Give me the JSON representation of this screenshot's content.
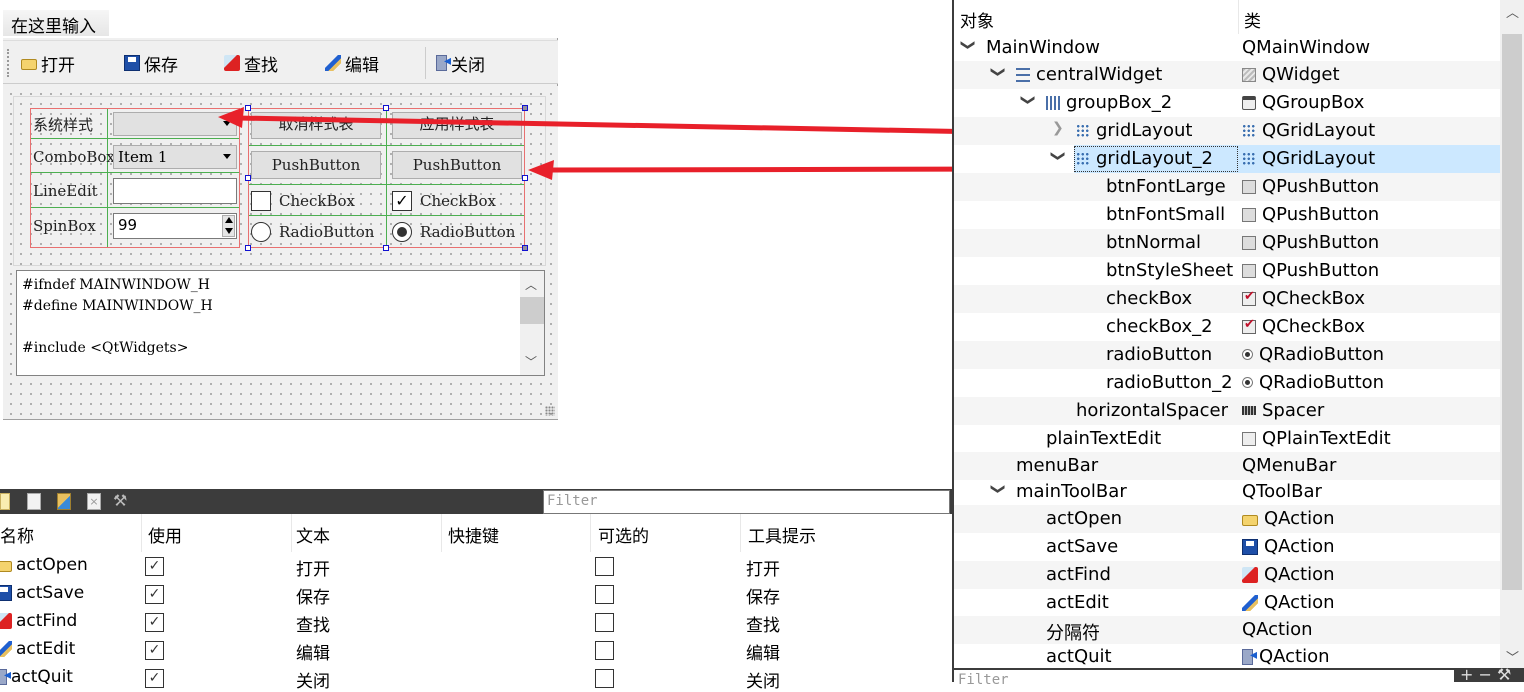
{
  "form": {
    "menu_placeholder": "在这里输入",
    "toolbar": [
      {
        "icon": "folder-open-icon",
        "label": "打开"
      },
      {
        "icon": "save-icon",
        "label": "保存"
      },
      {
        "icon": "find-icon",
        "label": "查找"
      },
      {
        "icon": "edit-icon",
        "label": "编辑"
      },
      {
        "icon": "quit-icon",
        "label": "关闭"
      }
    ],
    "grid1": {
      "labels": [
        "系统样式",
        "ComboBox",
        "LineEdit",
        "SpinBox"
      ],
      "style_combo_value": "",
      "combo_value": "Item 1",
      "lineedit_value": "",
      "spin_value": "99"
    },
    "grid2": {
      "buttons": [
        "取消样式表",
        "应用样式表",
        "PushButton",
        "PushButton"
      ],
      "checkboxes": [
        {
          "label": "CheckBox",
          "checked": false
        },
        {
          "label": "CheckBox",
          "checked": true
        }
      ],
      "radios": [
        {
          "label": "RadioButton",
          "checked": false
        },
        {
          "label": "RadioButton",
          "checked": true
        }
      ]
    },
    "plaintext_lines": [
      "#ifndef MAINWINDOW_H",
      "#define MAINWINDOW_H",
      "",
      "#include <QtWidgets>"
    ]
  },
  "action_editor": {
    "toolbar_icons": [
      "new-action-icon",
      "copy-action-icon",
      "paste-action-icon",
      "delete-action-icon",
      "configure-icon"
    ],
    "filter_placeholder": "Filter",
    "columns": [
      "名称",
      "使用",
      "文本",
      "快捷键",
      "可选的",
      "工具提示"
    ],
    "rows": [
      {
        "icon": "folder-open-icon",
        "name": "actOpen",
        "used": true,
        "text": "打开",
        "shortcut": "",
        "checkable": false,
        "tooltip": "打开"
      },
      {
        "icon": "save-icon",
        "name": "actSave",
        "used": true,
        "text": "保存",
        "shortcut": "",
        "checkable": false,
        "tooltip": "保存"
      },
      {
        "icon": "find-icon",
        "name": "actFind",
        "used": true,
        "text": "查找",
        "shortcut": "",
        "checkable": false,
        "tooltip": "查找"
      },
      {
        "icon": "edit-icon",
        "name": "actEdit",
        "used": true,
        "text": "编辑",
        "shortcut": "",
        "checkable": false,
        "tooltip": "编辑"
      },
      {
        "icon": "quit-icon",
        "name": "actQuit",
        "used": true,
        "text": "关闭",
        "shortcut": "",
        "checkable": false,
        "tooltip": "关闭"
      }
    ]
  },
  "inspector": {
    "headers": [
      "对象",
      "类"
    ],
    "filter_placeholder": "Filter",
    "rows": [
      {
        "name": "MainWindow",
        "cls": "QMainWindow",
        "level": 0,
        "expander": "open",
        "obj_icon": "",
        "cls_icon": ""
      },
      {
        "name": "centralWidget",
        "cls": "QWidget",
        "level": 1,
        "expander": "open",
        "obj_icon": "vbox-layout-icon",
        "cls_icon": "widget-icon"
      },
      {
        "name": "groupBox_2",
        "cls": "QGroupBox",
        "level": 2,
        "expander": "open",
        "obj_icon": "hbox-layout-icon",
        "cls_icon": "groupbox-icon"
      },
      {
        "name": "gridLayout",
        "cls": "QGridLayout",
        "level": 3,
        "expander": "closed",
        "obj_icon": "grid-layout-icon",
        "cls_icon": "grid-layout-icon"
      },
      {
        "name": "gridLayout_2",
        "cls": "QGridLayout",
        "level": 3,
        "expander": "open",
        "obj_icon": "grid-layout-icon",
        "cls_icon": "grid-layout-icon",
        "selected": true
      },
      {
        "name": "btnFontLarge",
        "cls": "QPushButton",
        "level": 4,
        "expander": "",
        "obj_icon": "",
        "cls_icon": "pushbutton-icon"
      },
      {
        "name": "btnFontSmall",
        "cls": "QPushButton",
        "level": 4,
        "expander": "",
        "obj_icon": "",
        "cls_icon": "pushbutton-icon"
      },
      {
        "name": "btnNormal",
        "cls": "QPushButton",
        "level": 4,
        "expander": "",
        "obj_icon": "",
        "cls_icon": "pushbutton-icon"
      },
      {
        "name": "btnStyleSheet",
        "cls": "QPushButton",
        "level": 4,
        "expander": "",
        "obj_icon": "",
        "cls_icon": "pushbutton-icon"
      },
      {
        "name": "checkBox",
        "cls": "QCheckBox",
        "level": 4,
        "expander": "",
        "obj_icon": "",
        "cls_icon": "checkbox-icon"
      },
      {
        "name": "checkBox_2",
        "cls": "QCheckBox",
        "level": 4,
        "expander": "",
        "obj_icon": "",
        "cls_icon": "checkbox-icon"
      },
      {
        "name": "radioButton",
        "cls": "QRadioButton",
        "level": 4,
        "expander": "",
        "obj_icon": "",
        "cls_icon": "radiobutton-icon"
      },
      {
        "name": "radioButton_2",
        "cls": "QRadioButton",
        "level": 4,
        "expander": "",
        "obj_icon": "",
        "cls_icon": "radiobutton-icon"
      },
      {
        "name": "horizontalSpacer",
        "cls": "Spacer",
        "level": 3,
        "expander": "",
        "obj_icon": "",
        "cls_icon": "spacer-icon"
      },
      {
        "name": "plainTextEdit",
        "cls": "QPlainTextEdit",
        "level": 2,
        "expander": "",
        "obj_icon": "",
        "cls_icon": "plaintextedit-icon"
      },
      {
        "name": "menuBar",
        "cls": "QMenuBar",
        "level": 1,
        "expander": "",
        "obj_icon": "",
        "cls_icon": ""
      },
      {
        "name": "mainToolBar",
        "cls": "QToolBar",
        "level": 1,
        "expander": "open",
        "obj_icon": "",
        "cls_icon": ""
      },
      {
        "name": "actOpen",
        "cls": "QAction",
        "level": 2,
        "expander": "",
        "obj_icon": "",
        "cls_icon": "folder-open-icon"
      },
      {
        "name": "actSave",
        "cls": "QAction",
        "level": 2,
        "expander": "",
        "obj_icon": "",
        "cls_icon": "save-icon"
      },
      {
        "name": "actFind",
        "cls": "QAction",
        "level": 2,
        "expander": "",
        "obj_icon": "",
        "cls_icon": "find-icon"
      },
      {
        "name": "actEdit",
        "cls": "QAction",
        "level": 2,
        "expander": "",
        "obj_icon": "",
        "cls_icon": "edit-icon"
      },
      {
        "name": "分隔符",
        "cls": "QAction",
        "level": 2,
        "expander": "",
        "obj_icon": "",
        "cls_icon": ""
      },
      {
        "name": "actQuit",
        "cls": "QAction",
        "level": 2,
        "expander": "",
        "obj_icon": "",
        "cls_icon": "quit-icon"
      }
    ]
  },
  "colors": {
    "annotation_arrow": "#e8202a",
    "selection": "#cce8ff",
    "layout_border": "#e87070",
    "grid_line": "#4caf50"
  }
}
